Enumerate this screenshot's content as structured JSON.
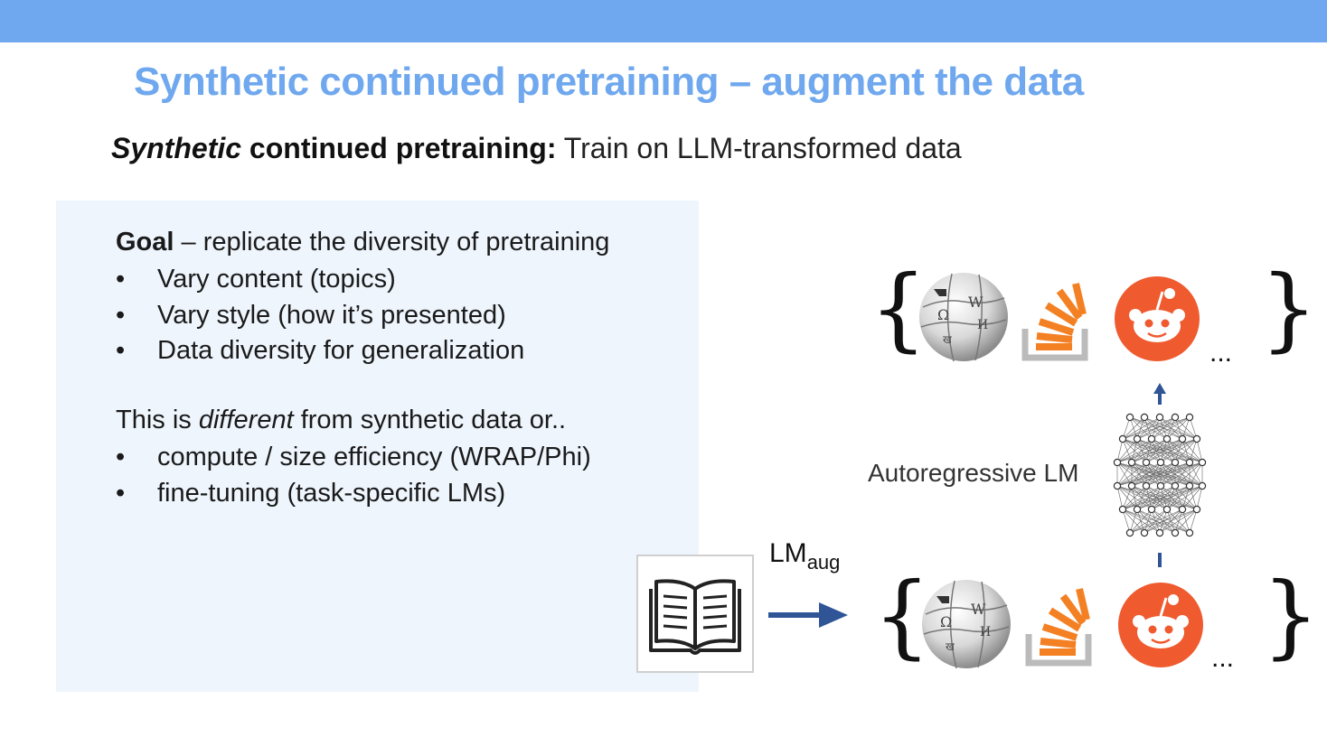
{
  "slide": {
    "title": "Synthetic continued pretraining – augment the data",
    "subtitle": {
      "italic_bold": "Synthetic",
      "bold": " continued pretraining:",
      "rest": " Train on LLM-transformed data"
    }
  },
  "panel": {
    "goal_bold": "Goal",
    "goal_rest": " – replicate the diversity of pretraining",
    "goal_items": [
      "Vary content (topics)",
      "Vary style (how it’s presented)",
      "Data diversity for generalization"
    ],
    "diff_pre": "This is ",
    "diff_italic": "different",
    "diff_post": " from synthetic data or..",
    "diff_items": [
      "compute / size efficiency (WRAP/Phi)",
      "fine-tuning (task-specific LMs)"
    ],
    "bullet_char": "•"
  },
  "diagram": {
    "lm_main": "LM",
    "lm_sub": "aug",
    "model_label": "Autoregressive LM",
    "brace_open": "{",
    "brace_close": "}",
    "ellipsis": "...",
    "icons": [
      "book-icon",
      "wikipedia-globe-icon",
      "stackoverflow-icon",
      "reddit-icon",
      "neural-network-icon"
    ]
  },
  "colors": {
    "accent": "#6fa8ee",
    "panel_bg": "#eef5fd",
    "arrow": "#2f5597",
    "reddit": "#ef5a2f",
    "stack_orange": "#f48024",
    "stack_gray": "#bcbbbb"
  }
}
